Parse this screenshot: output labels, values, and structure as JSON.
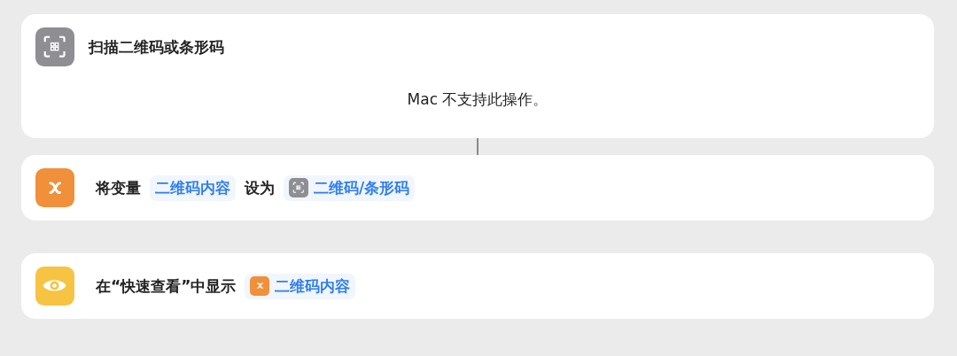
{
  "actions": [
    {
      "kind": "scan",
      "title": "扫描二维码或条形码",
      "message": "Mac 不支持此操作。"
    },
    {
      "kind": "set_variable",
      "parts": [
        {
          "kind": "text",
          "text": "将变量"
        },
        {
          "kind": "token",
          "text": "二维码内容"
        },
        {
          "kind": "text",
          "text": "设为"
        },
        {
          "kind": "scan_token",
          "text": "二维码/条形码"
        }
      ]
    },
    {
      "kind": "quick_look",
      "parts": [
        {
          "kind": "text",
          "text": "在“快速查看”中显示"
        },
        {
          "kind": "variable_token",
          "text": "二维码内容"
        }
      ]
    }
  ]
}
